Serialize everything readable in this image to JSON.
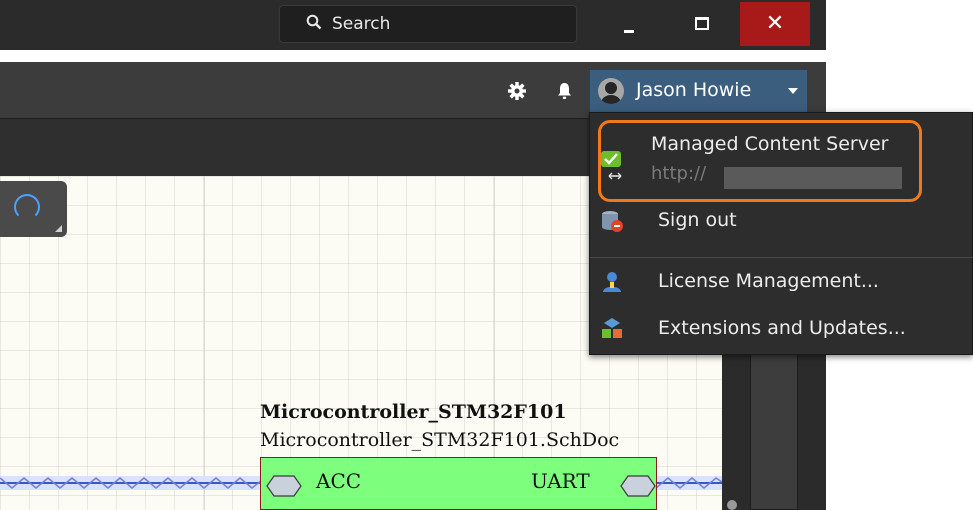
{
  "titlebar": {
    "search_label": "Search",
    "close_glyph": "✕",
    "colors": {
      "background": "#2b2b2b",
      "close_button": "#a81a1a"
    }
  },
  "toolbar": {
    "icons": [
      "gear-icon",
      "bell-icon"
    ],
    "user_name": "Jason Howie",
    "user_button_color": "#3b5e7e"
  },
  "menu": {
    "items": [
      {
        "label": "Managed Content Server",
        "sublabel": "http://",
        "icon": "server-connected-icon"
      },
      {
        "label": "Sign out",
        "icon": "sign-out-icon"
      },
      {
        "label": "License Management...",
        "icon": "license-icon"
      },
      {
        "label": "Extensions and Updates...",
        "icon": "extensions-icon"
      }
    ],
    "highlight_color": "#f07a1b"
  },
  "schematic": {
    "sheet_symbol_title": "Microcontroller_STM32F101",
    "sheet_file": "Microcontroller_STM32F101.SchDoc",
    "ports": [
      "ACC",
      "UART"
    ],
    "sheet_fill_color": "#7dfe7d"
  }
}
